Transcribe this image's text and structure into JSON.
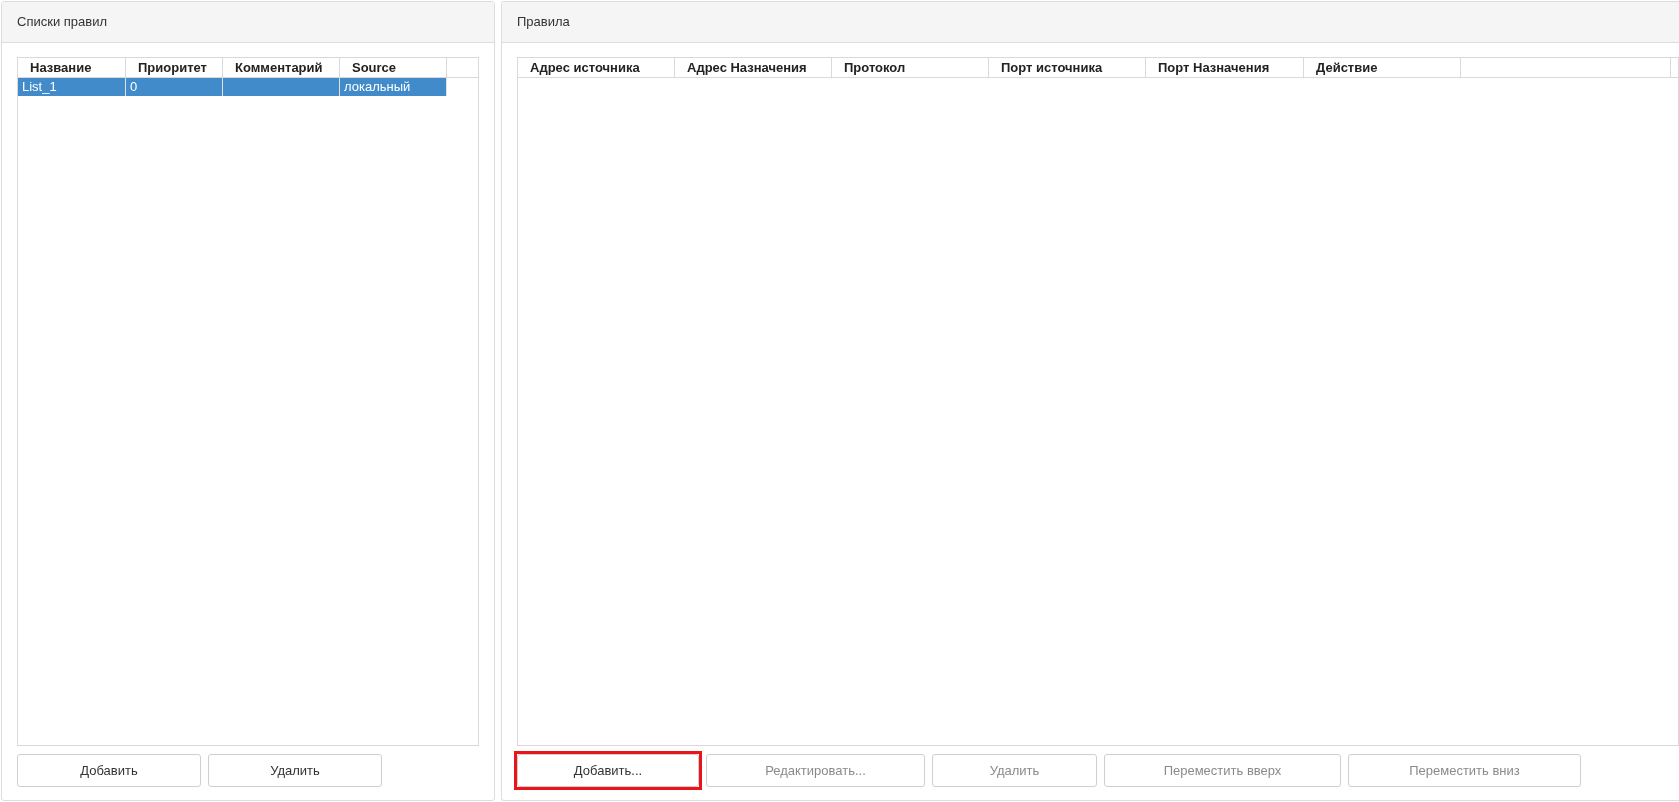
{
  "lists_panel": {
    "title": "Списки правил",
    "table": {
      "columns": [
        "Название",
        "Приоритет",
        "Комментарий",
        "Source"
      ],
      "rows": [
        {
          "cells": [
            "List_1",
            "0",
            "",
            "локальный"
          ],
          "selected": true
        }
      ]
    },
    "buttons": [
      {
        "label": "Добавить",
        "disabled": false,
        "highlighted": false
      },
      {
        "label": "Удалить",
        "disabled": false,
        "highlighted": false
      }
    ]
  },
  "rules_panel": {
    "title": "Правила",
    "table": {
      "columns": [
        "Адрес источника",
        "Адрес Назначения",
        "Протокол",
        "Порт источника",
        "Порт Назначения",
        "Действие"
      ]
    },
    "buttons": [
      {
        "label": "Добавить...",
        "disabled": false,
        "highlighted": true
      },
      {
        "label": "Редактировать...",
        "disabled": true,
        "highlighted": false
      },
      {
        "label": "Удалить",
        "disabled": true,
        "highlighted": false
      },
      {
        "label": "Переместить вверх",
        "disabled": true,
        "highlighted": false
      },
      {
        "label": "Переместить вниз",
        "disabled": true,
        "highlighted": false
      }
    ]
  }
}
